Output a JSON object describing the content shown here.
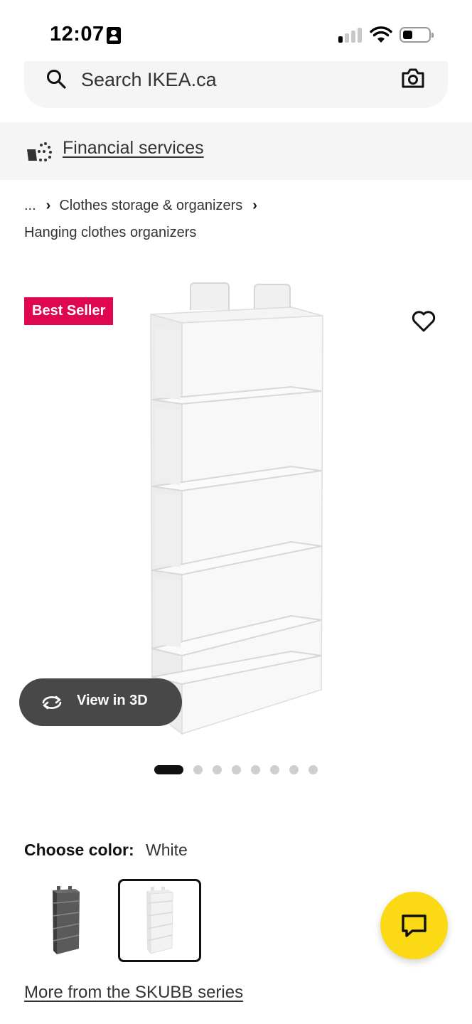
{
  "status_bar": {
    "time": "12:07",
    "battery_level": 0.35,
    "signal_bars_on": 1
  },
  "search": {
    "placeholder": "Search IKEA.ca"
  },
  "banner": {
    "financial_services_label": "Financial services"
  },
  "breadcrumb": {
    "ellipsis": "...",
    "items": [
      "Clothes storage & organizers",
      "Hanging clothes organizers"
    ]
  },
  "product": {
    "badge": "Best Seller",
    "view_3d_label": "View in 3D",
    "carousel_total": 8,
    "carousel_active_index": 0,
    "color_label": "Choose color:",
    "color_value": "White",
    "colors": [
      "Dark gray",
      "White"
    ],
    "selected_color_index": 1,
    "series_link": "More from the SKUBB series"
  },
  "colors": {
    "badge_bg": "#e00751",
    "chat_bg": "#fbd914",
    "view3d_bg": "#484848",
    "surface": "#f5f5f5"
  },
  "icons": [
    "id-card-icon",
    "signal-icon",
    "wifi-icon",
    "battery-icon",
    "search-icon",
    "camera-icon",
    "financial-services-icon",
    "heart-icon",
    "rotate-3d-icon",
    "chat-icon"
  ]
}
